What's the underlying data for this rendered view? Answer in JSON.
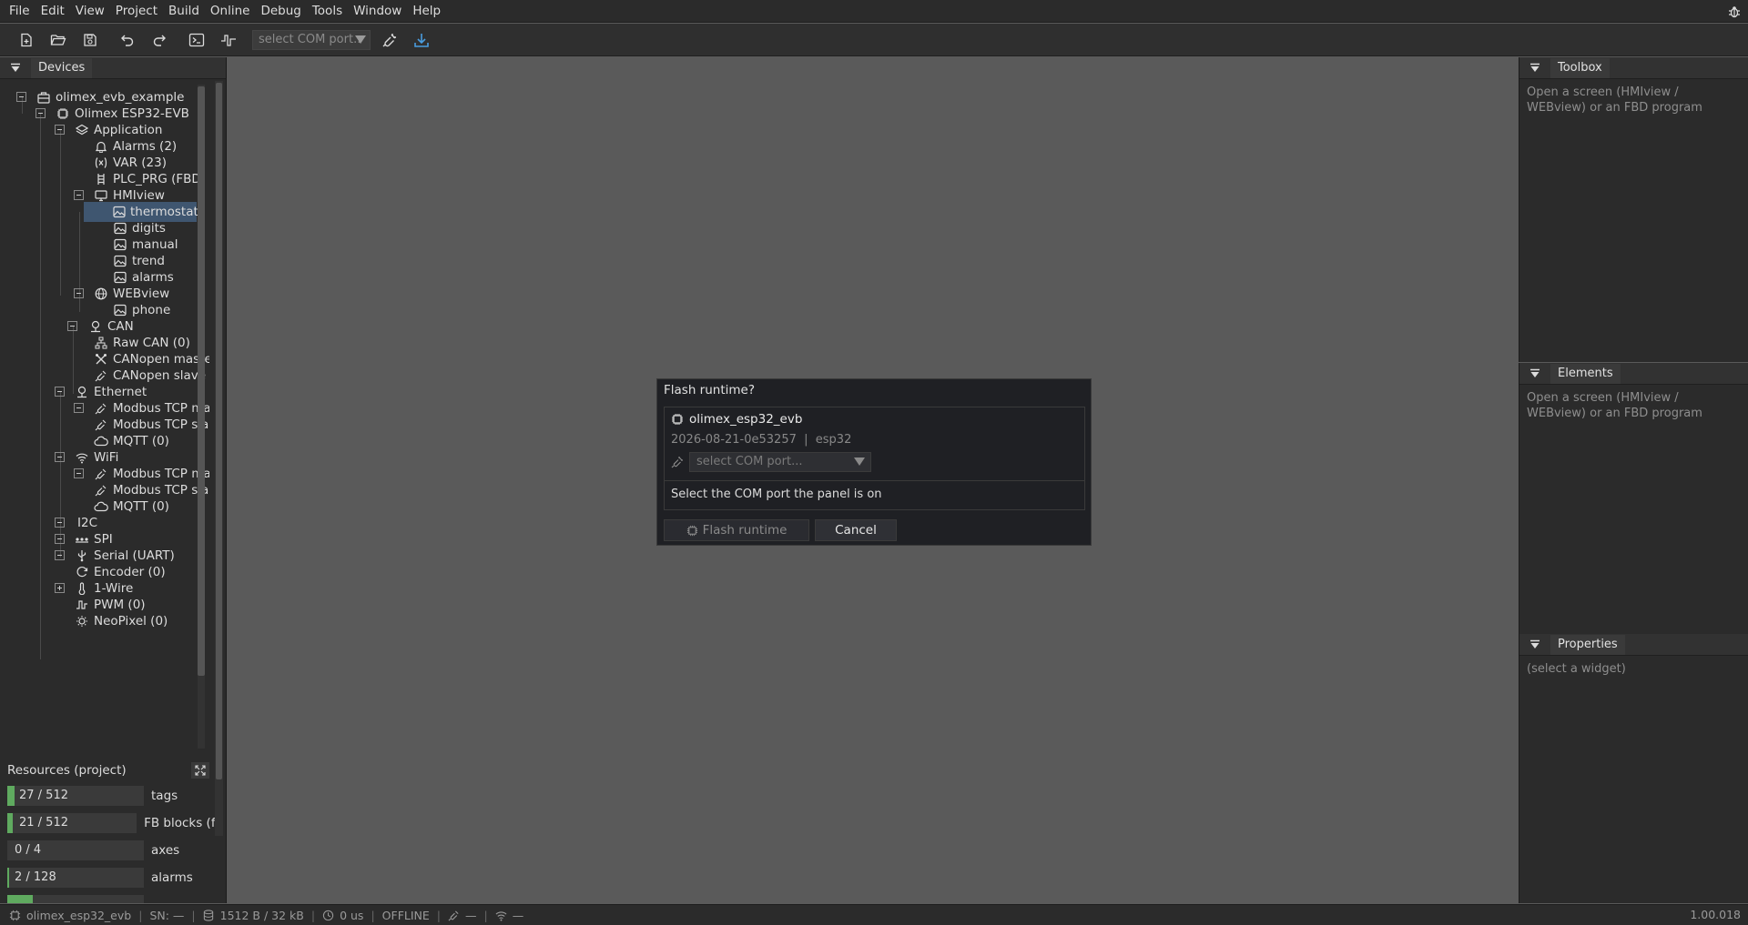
{
  "menubar": {
    "items": [
      "File",
      "Edit",
      "View",
      "Project",
      "Build",
      "Online",
      "Debug",
      "Tools",
      "Window",
      "Help"
    ]
  },
  "toolbar": {
    "com_port_placeholder": "select COM port.."
  },
  "devices_panel": {
    "tab_label": "Devices",
    "tree": [
      {
        "label": "olimex_evb_example",
        "icon": "project-icon"
      },
      {
        "label": "Olimex ESP32-EVB",
        "icon": "chip-icon"
      },
      {
        "label": "Application",
        "icon": "layers-icon"
      },
      {
        "label": "Alarms (2)",
        "icon": "bell-icon"
      },
      {
        "label": "VAR (23)",
        "icon": "variable-icon"
      },
      {
        "label": "PLC_PRG (FBD, :",
        "icon": "ladder-icon"
      },
      {
        "label": "HMIview",
        "icon": "monitor-icon"
      },
      {
        "label": "thermostat",
        "icon": "image-icon"
      },
      {
        "label": "digits",
        "icon": "image-icon"
      },
      {
        "label": "manual",
        "icon": "image-icon"
      },
      {
        "label": "trend",
        "icon": "image-icon"
      },
      {
        "label": "alarms",
        "icon": "image-icon"
      },
      {
        "label": "WEBview",
        "icon": "globe-icon"
      },
      {
        "label": "phone",
        "icon": "image-icon"
      },
      {
        "label": "CAN",
        "icon": "network-icon"
      },
      {
        "label": "Raw CAN (0)",
        "icon": "network-node-icon"
      },
      {
        "label": "CANopen maste",
        "icon": "tools-icon"
      },
      {
        "label": "CANopen slave",
        "icon": "plug-icon"
      },
      {
        "label": "Ethernet",
        "icon": "network-icon"
      },
      {
        "label": "Modbus TCP ma",
        "icon": "plug-icon"
      },
      {
        "label": "Modbus TCP sla",
        "icon": "plug-icon"
      },
      {
        "label": "MQTT (0)",
        "icon": "cloud-icon"
      },
      {
        "label": "WiFi",
        "icon": "wifi-icon"
      },
      {
        "label": "Modbus TCP ma",
        "icon": "plug-icon"
      },
      {
        "label": "Modbus TCP sla",
        "icon": "plug-icon"
      },
      {
        "label": "MQTT (0)",
        "icon": "cloud-icon"
      },
      {
        "label": "I2C",
        "icon": "none"
      },
      {
        "label": "SPI",
        "icon": "spi-icon"
      },
      {
        "label": "Serial (UART)",
        "icon": "usb-icon"
      },
      {
        "label": "Encoder (0)",
        "icon": "encoder-icon"
      },
      {
        "label": "1-Wire",
        "icon": "thermometer-icon"
      },
      {
        "label": "PWM (0)",
        "icon": "pwm-icon"
      },
      {
        "label": "NeoPixel (0)",
        "icon": "bulb-icon"
      }
    ]
  },
  "resources": {
    "title": "Resources (project)",
    "rows": [
      {
        "value": "27 / 512",
        "label": "tags",
        "fill": 0.053
      },
      {
        "value": "21 / 512",
        "label": "FB blocks (fl",
        "fill": 0.041
      },
      {
        "value": "0 / 4",
        "label": "axes",
        "fill": 0
      },
      {
        "value": "2 / 128",
        "label": "alarms",
        "fill": 0.016
      }
    ]
  },
  "toolbox_panel": {
    "tab_label": "Toolbox",
    "placeholder": "Open a screen (HMIview / WEBview) or an FBD program"
  },
  "elements_panel": {
    "tab_label": "Elements",
    "placeholder": "Open a screen (HMIview / WEBview) or an FBD program"
  },
  "properties_panel": {
    "tab_label": "Properties",
    "placeholder": "(select a widget)"
  },
  "dialog": {
    "title": "Flash runtime?",
    "device_name": "olimex_esp32_evb",
    "device_meta": "2026-08-21-0e53257  |  esp32",
    "com_placeholder": "select COM port...",
    "hint": "Select the COM port the panel is on",
    "flash_label": "Flash runtime",
    "cancel_label": "Cancel"
  },
  "statusbar": {
    "device": "olimex_esp32_evb",
    "serial": "SN: —",
    "memory": "1512 B / 32 kB",
    "cycle": "0 us",
    "state": "OFFLINE",
    "conn": "—",
    "wifi": "—",
    "version": "1.00.018"
  },
  "colors": {
    "accent": "#3f5670",
    "resource_fill": "#5faa5f",
    "download_icon": "#4a9de0"
  }
}
